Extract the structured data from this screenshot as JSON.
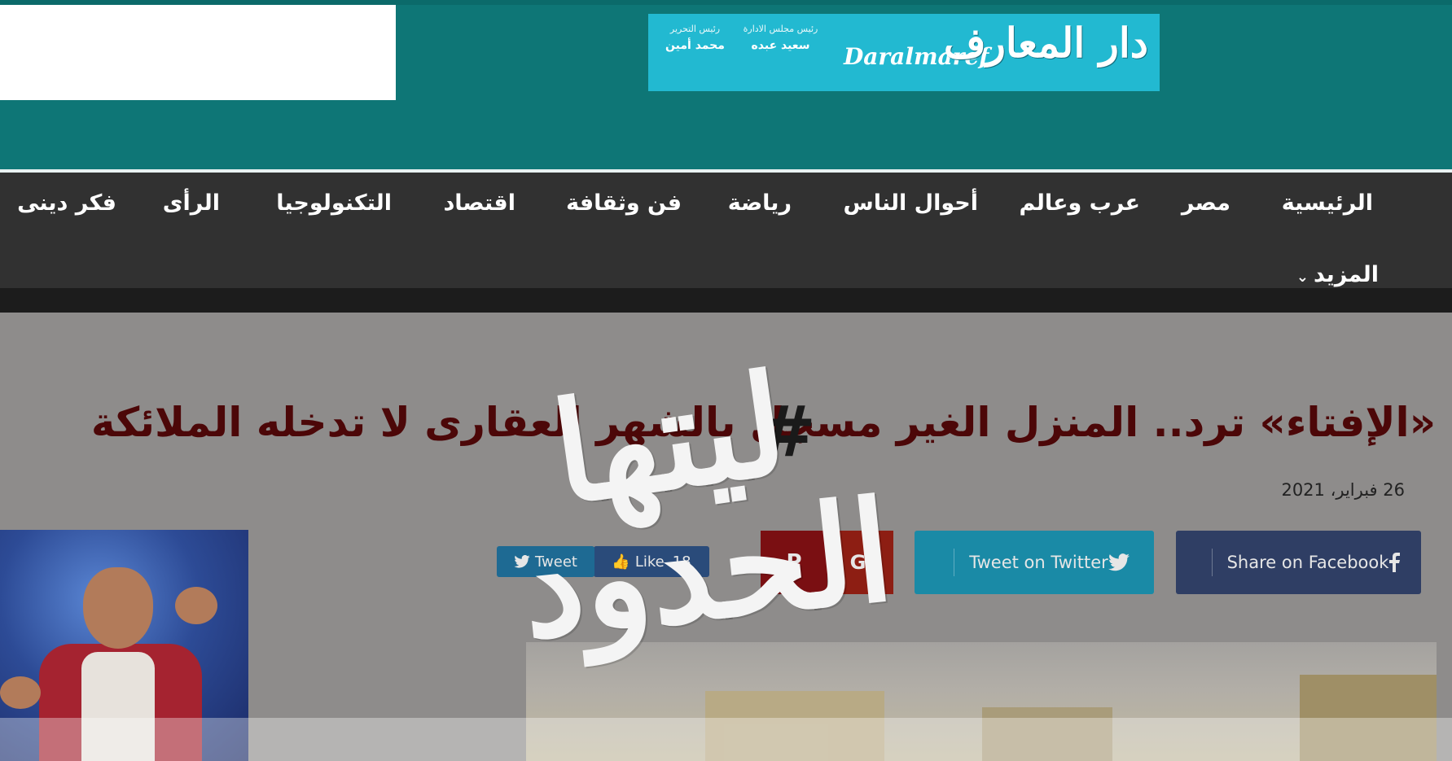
{
  "header": {
    "banner": {
      "logo_ar": "دار المعارف",
      "logo_en": "Daralmaref",
      "staff": [
        {
          "role": "رئيس مجلس الادارة",
          "name": "سعيد عبده"
        },
        {
          "role": "رئيس التحرير",
          "name": "محمد أمين"
        }
      ]
    }
  },
  "nav": {
    "items": [
      "الرئيسية",
      "مصر",
      "عرب وعالم",
      "أحوال الناس",
      "رياضة",
      "فن وثقافة",
      "اقتصاد",
      "التكنولوجيا",
      "الرأى",
      "فكر دينى"
    ],
    "more_label": "المزيد",
    "more_icon": "chevron-down-icon"
  },
  "article": {
    "headline": "«الإفتاء» ترد.. المنزل الغير مسجل بالشهر العقارى لا تدخله الملائكة",
    "date": "26 فبراير، 2021",
    "share": {
      "facebook_label": "Share on Facebook",
      "twitter_label": "Tweet on Twitter",
      "like_label": "Like",
      "like_count": "18",
      "tweet_label": "Tweet"
    }
  },
  "watermark": {
    "hashtag": "#",
    "line1": "ليتها",
    "line2": "الحدود"
  },
  "colors": {
    "header": "#0e7676",
    "nav": "#313131",
    "headline": "#4c0708",
    "facebook": "#2f3e64",
    "twitter": "#1a8aa6",
    "googleplus": "#8d1e13"
  }
}
